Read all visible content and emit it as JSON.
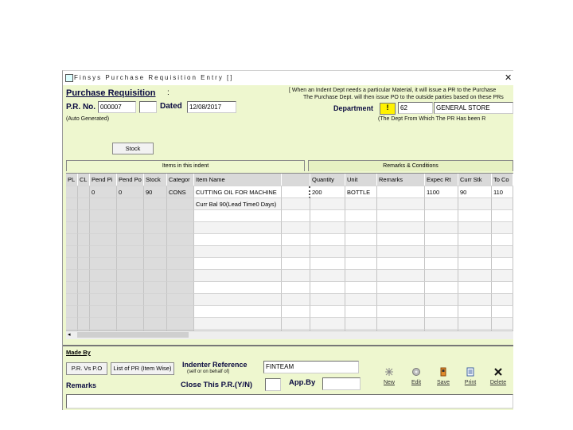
{
  "window": {
    "title": "Finsys Purchase Requisition Entry []",
    "close_glyph": "✕"
  },
  "header": {
    "heading": "Purchase Requisition",
    "colon": ":",
    "pr_no_label": "P.R. No.",
    "pr_no_value": "000007",
    "pr_no_extra": "",
    "dated_label": "Dated",
    "dated_value": "12/08/2017",
    "auto_generated": "(Auto Generated)",
    "info_line1": "[ When an Indent Dept needs a particular Material, it will issue a PR to the Purchase",
    "info_line2": "The Purchase Dept. will then issue PO to the outside parties based on these PRs",
    "department_label": "Department",
    "department_button": "!",
    "department_code": "62",
    "department_name": "GENERAL STORE",
    "department_note": "(The Dept From Which The PR Has been R",
    "stock_button": "Stock"
  },
  "tabs": {
    "items": "Items in this indent",
    "remarks": "Remarks & Conditions"
  },
  "grid": {
    "columns": [
      "PL",
      "CL",
      "Pend Pi",
      "Pend Po",
      "Stock",
      "Categor",
      "Item Name",
      "",
      "Quantity",
      "Unit",
      "Remarks",
      "Expec Rt",
      "Curr Stk",
      "To Co"
    ],
    "rows": [
      [
        "",
        "",
        "0",
        "0",
        "90",
        "CONS",
        "CUTTING OIL FOR MACHINE",
        "",
        "200",
        "BOTTLE",
        "",
        "1100",
        "90",
        "110"
      ],
      [
        "",
        "",
        "",
        "",
        "",
        "",
        "Curr Bal 90(Lead Time0 Days)",
        "",
        "",
        "",
        "",
        "",
        "",
        ""
      ]
    ]
  },
  "bottom": {
    "made_by_label": "Made By",
    "pr_vs_po_button": "P.R. Vs P.O",
    "list_button": "List of PR (Item Wise)",
    "indenter_label": "Indenter Reference",
    "indenter_sublabel": "(self or on behalf of)",
    "indenter_value": "FINTEAM",
    "remarks_label": "Remarks",
    "close_pr_label": "Close This P.R.(Y/N)",
    "close_pr_value": "",
    "app_by_label": "App.By",
    "app_by_value": "",
    "remarks_value": ""
  },
  "toolbar": [
    {
      "label": "New",
      "icon": "new-icon"
    },
    {
      "label": "Edit",
      "icon": "edit-icon"
    },
    {
      "label": "Save",
      "icon": "save-icon"
    },
    {
      "label": "Print",
      "icon": "print-icon"
    },
    {
      "label": "Delete",
      "icon": "delete-icon"
    }
  ]
}
